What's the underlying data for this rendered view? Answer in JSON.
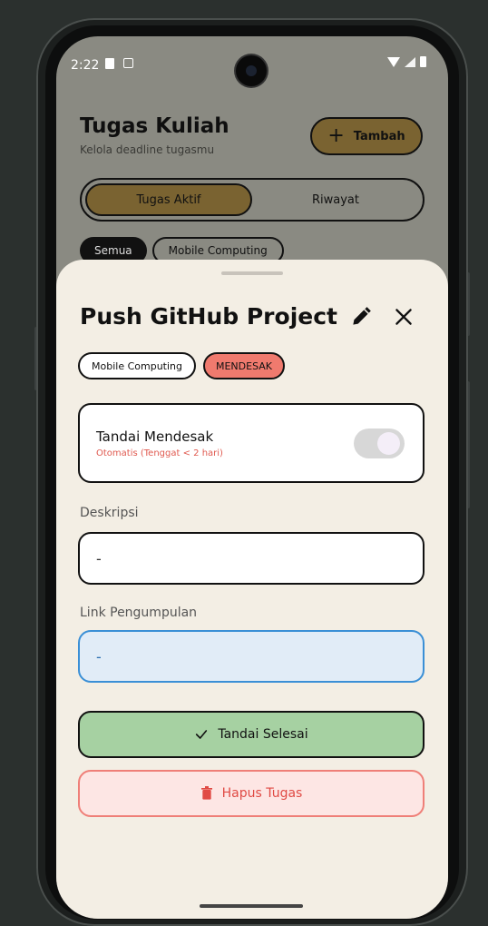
{
  "status_bar": {
    "time": "2:22"
  },
  "background_page": {
    "title": "Tugas Kuliah",
    "subtitle": "Kelola deadline tugasmu",
    "add_button": "Tambah",
    "segments": [
      "Tugas Aktif",
      "Riwayat"
    ],
    "filters": [
      "Semua",
      "Mobile Computing"
    ]
  },
  "sheet": {
    "title": "Push GitHub Project",
    "tags": [
      "Mobile Computing",
      "MENDESAK"
    ],
    "urgent_card": {
      "label": "Tandai Mendesak",
      "hint": "Otomatis (Tenggat < 2 hari)",
      "toggle_on": true
    },
    "description": {
      "label": "Deskripsi",
      "value": "-"
    },
    "submission_link": {
      "label": "Link Pengumpulan",
      "value": "-"
    },
    "done_button": "Tandai Selesai",
    "delete_button": "Hapus Tugas"
  },
  "colors": {
    "accent": "#7a6331",
    "sheet_bg": "#f3eee4",
    "urgent": "#f07a6e",
    "done": "#a6d1a2",
    "delete": "#e04a44"
  }
}
